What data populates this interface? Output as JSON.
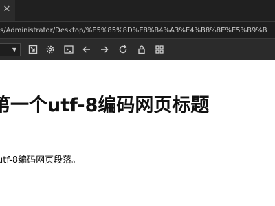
{
  "tab": {
    "close_icon": "close-icon"
  },
  "address_bar": {
    "url": "s/Administrator/Desktop/%E5%85%8D%E8%B4%A3%E4%B8%8E%E5%B9%B"
  },
  "toolbar": {
    "icons": [
      "dropdown-caret-icon",
      "open-external-icon",
      "settings-icon",
      "terminal-icon",
      "back-arrow-icon",
      "forward-arrow-icon",
      "refresh-icon",
      "lock-icon",
      "grid-icon"
    ]
  },
  "page": {
    "heading": "第一个utf-8编码网页标题",
    "paragraph": "utf-8编码网页段落。"
  },
  "colors": {
    "chrome_bg": "#2b2b2b",
    "tab_strip_bg": "#202020",
    "address_bg": "#1e1e1e",
    "icon_color": "#d0d0d0",
    "page_bg": "#ffffff",
    "text_color": "#111111"
  }
}
